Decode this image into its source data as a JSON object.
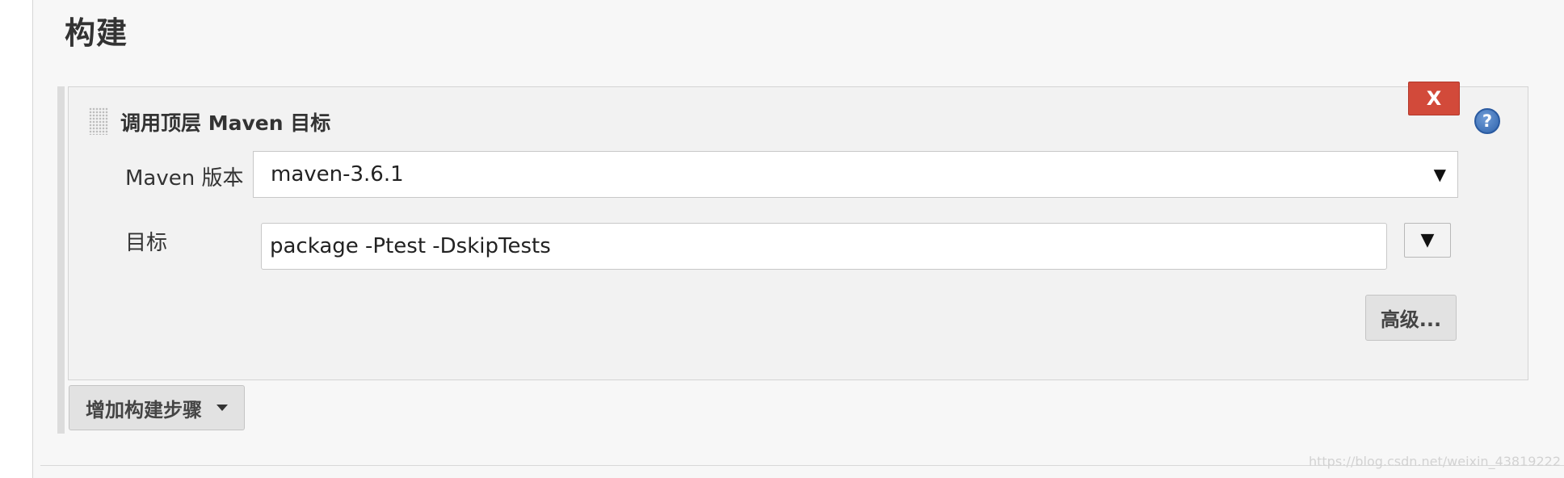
{
  "section": {
    "title": "构建"
  },
  "step": {
    "title": "调用顶层 Maven 目标",
    "delete_label": "X",
    "help_label": "?",
    "maven_version_label": "Maven 版本",
    "maven_version_value": "maven-3.6.1",
    "select_arrow": "▼",
    "goal_label": "目标",
    "goal_value": "package -Ptest -DskipTests",
    "expand_arrow": "▼",
    "advanced_label": "高级..."
  },
  "add_step": {
    "label": "增加构建步骤"
  },
  "watermark": "https://blog.csdn.net/weixin_43819222",
  "colors": {
    "delete": "#d24a3a",
    "help": "#2f64ad",
    "background": "#f7f7f7"
  }
}
